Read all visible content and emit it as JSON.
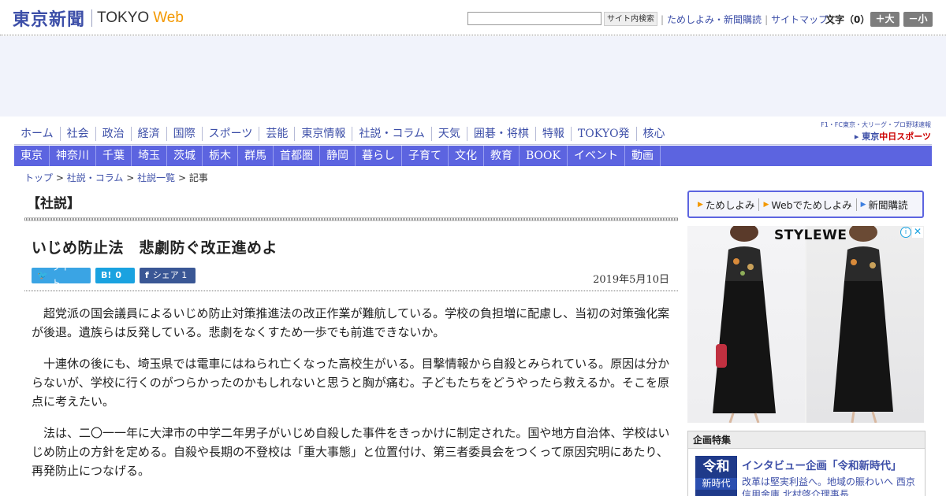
{
  "header": {
    "logo_jp": "東京新聞",
    "logo_tokyo": "TOKYO",
    "logo_web": "Web",
    "search_placeholder": "",
    "search_button": "サイト内検索",
    "links": [
      "ためしよみ・新聞購読",
      "サイトマップ"
    ],
    "font_size_label": "文字（0）",
    "font_plus": "＋大",
    "font_minus": "－小"
  },
  "main_nav": [
    "ホーム",
    "社会",
    "政治",
    "経済",
    "国際",
    "スポーツ",
    "芸能",
    "東京情報",
    "社説・コラム",
    "天気",
    "囲碁・将棋",
    "特報",
    "TOKYO発",
    "核心"
  ],
  "chunichi": {
    "top": "F1・FC東京・大リーグ・プロ野球速報",
    "bottom_prefix": "▸ 東京",
    "bottom_brand": "中日スポーツ"
  },
  "region_nav": [
    "東京",
    "神奈川",
    "千葉",
    "埼玉",
    "茨城",
    "栃木",
    "群馬",
    "首都圏",
    "静岡",
    "暮らし",
    "子育て",
    "文化",
    "教育",
    "BOOK",
    "イベント",
    "動画"
  ],
  "breadcrumb": {
    "items": [
      "トップ",
      "社説・コラム",
      "社説一覧"
    ],
    "current": "記事",
    "separator": ">"
  },
  "section_label": "【社説】",
  "article": {
    "title": "いじめ防止法　悲劇防ぐ改正進めよ",
    "date": "2019年5月10日",
    "paragraphs": [
      "超党派の国会議員によるいじめ防止対策推進法の改正作業が難航している。学校の負担増に配慮し、当初の対策強化案が後退。遺族らは反発している。悲劇をなくすため一歩でも前進できないか。",
      "十連休の後にも、埼玉県では電車にはねられ亡くなった高校生がいる。目撃情報から自殺とみられている。原因は分からないが、学校に行くのがつらかったのかもしれないと思うと胸が痛む。子どもたちをどうやったら救えるか。そこを原点に考えたい。",
      "法は、二〇一一年に大津市の中学二年男子がいじめ自殺した事件をきっかけに制定された。国や地方自治体、学校はいじめ防止の方針を定める。自殺や長期の不登校は「重大事態」と位置付け、第三者委員会をつくって原因究明にあたり、再発防止につなげる。"
    ]
  },
  "social": {
    "tweet_label": "ツイート",
    "hatena_label": "0",
    "share_label": "シェア 1"
  },
  "sidebar": {
    "promo_links": [
      "ためしよみ",
      "Webでためしよみ",
      "新聞購読"
    ],
    "ad_brand": "STYLEWE",
    "feature": {
      "heading": "企画特集",
      "thumb_line1": "令和",
      "thumb_line2": "新時代",
      "title": "インタビュー企画「令和新時代」",
      "text": "改革は堅実利益へ。地域の賑わいへ 西京信用金庫 北村啓介理事長"
    }
  },
  "colors": {
    "brand_blue": "#3d4fa8",
    "region_nav_bg": "#5c64e0",
    "web_orange": "#f39800"
  }
}
